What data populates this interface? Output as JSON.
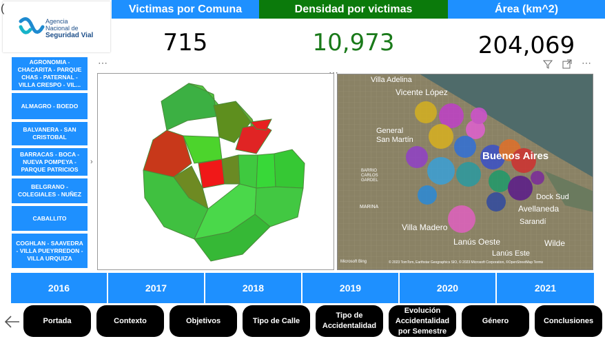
{
  "header": {
    "tabs": [
      {
        "label": "Victimas por Comuna",
        "color": "#1e90ff"
      },
      {
        "label": "Densidad por victimas",
        "color": "#0b7a0b"
      },
      {
        "label": "Área (km^2)",
        "color": "#1e90ff"
      }
    ]
  },
  "logo": {
    "line1": "Agencia",
    "line2": "Nacional de",
    "line3": "Seguridad Vial"
  },
  "kpis": [
    {
      "value": "715",
      "color": "#000000"
    },
    {
      "value": "10,973",
      "color": "#1a7a1a"
    },
    {
      "value": "204,069",
      "color": "#000000"
    }
  ],
  "sidebar": {
    "items": [
      {
        "label": "AGRONOMIA - CHACARITA - PARQUE CHAS - PATERNAL - VILLA CRESPO - VIL..."
      },
      {
        "label": "ALMAGRO - BOEDO"
      },
      {
        "label": "BALVANERA - SAN CRISTOBAL"
      },
      {
        "label": "BARRACAS - BOCA - NUEVA POMPEYA - PARQUE PATRICIOS"
      },
      {
        "label": "BELGRANO - COLEGIALES - NUÑEZ"
      },
      {
        "label": "CABALLITO"
      },
      {
        "label": "COGHLAN - SAAVEDRA - VILLA PUEYRREDON - VILLA URQUIZA"
      }
    ]
  },
  "map": {
    "places": [
      "Villa Adelina",
      "Vicente López",
      "General San Martín",
      "BARRIO CARLOS GARDEL",
      "Buenos Aires",
      "MARINA",
      "Villa Madero",
      "Dock Sud",
      "Avellaneda",
      "Sarandí",
      "Lanús Oeste",
      "Lanús Este",
      "Wilde"
    ],
    "attribution": "© 2023 TomTom, Earthstar Geographics SIO, © 2023 Microsoft Corporation, ©OpenStreetMap Terms",
    "brand": "Microsoft Bing"
  },
  "years": [
    "2016",
    "2017",
    "2018",
    "2019",
    "2020",
    "2021"
  ],
  "nav": [
    "Portada",
    "Contexto",
    "Objetivos",
    "Tipo de Calle",
    "Tipo de Accidentalidad",
    "Evolución Accidentalidad por Semestre",
    "Género",
    "Conclusiones"
  ]
}
